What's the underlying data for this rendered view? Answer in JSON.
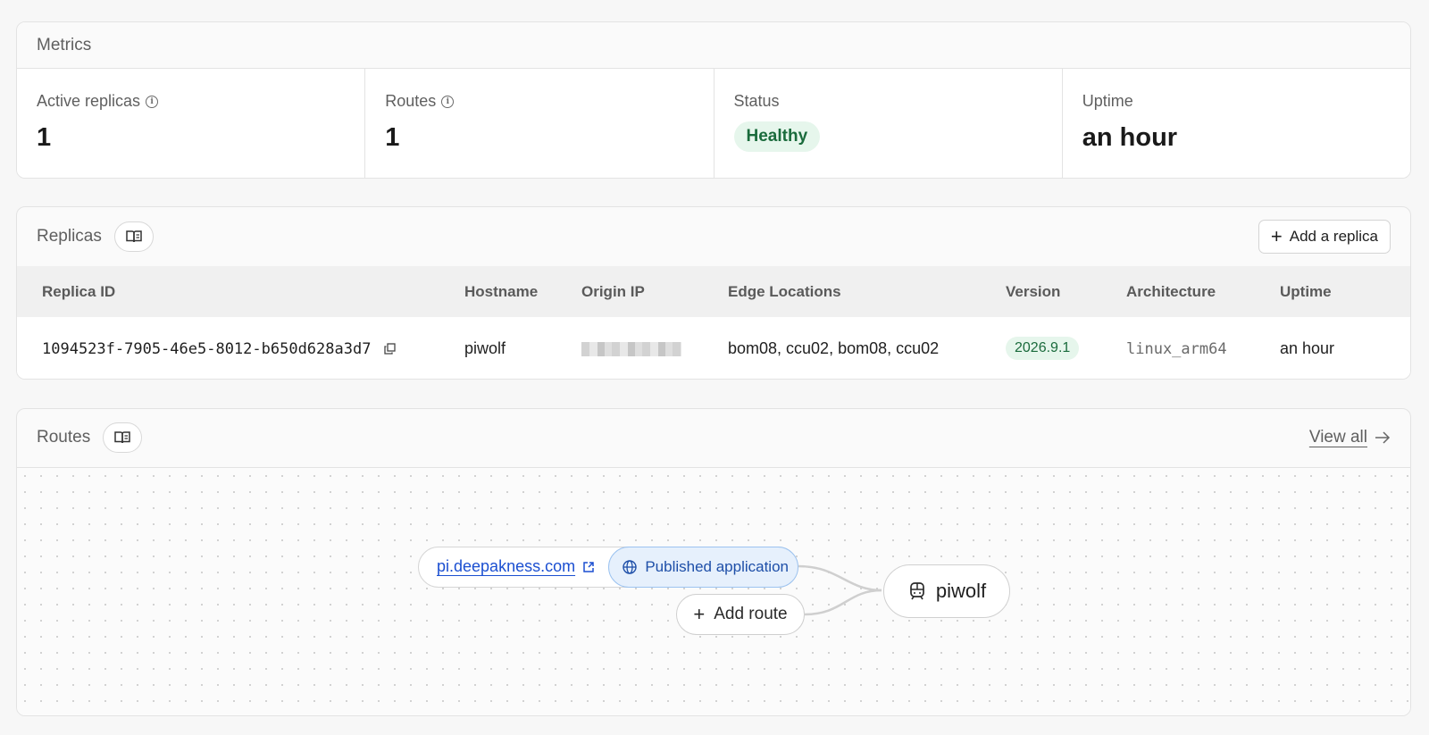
{
  "metrics": {
    "title": "Metrics",
    "items": [
      {
        "label": "Active replicas",
        "value": "1",
        "has_info": true
      },
      {
        "label": "Routes",
        "value": "1",
        "has_info": true
      },
      {
        "label": "Status",
        "value": "Healthy",
        "type": "badge"
      },
      {
        "label": "Uptime",
        "value": "an hour"
      }
    ]
  },
  "replicas": {
    "title": "Replicas",
    "add_button": "Add a replica",
    "columns": [
      "Replica ID",
      "Hostname",
      "Origin IP",
      "Edge Locations",
      "Version",
      "Architecture",
      "Uptime"
    ],
    "rows": [
      {
        "replica_id": "1094523f-7905-46e5-8012-b650d628a3d7",
        "hostname": "piwolf",
        "edge_locations": "bom08, ccu02, bom08, ccu02",
        "version": "2026.9.1",
        "architecture": "linux_arm64",
        "uptime": "an hour"
      }
    ]
  },
  "routes": {
    "title": "Routes",
    "view_all": "View all",
    "route_host": "pi.deepakness.com",
    "route_type": "Published application",
    "add_route": "Add route",
    "target": "piwolf"
  },
  "colors": {
    "healthy_bg": "#e6f6ec",
    "healthy_text": "#1a6b3c",
    "link": "#1b4fd1",
    "published_bg": "#e6f0fc"
  }
}
